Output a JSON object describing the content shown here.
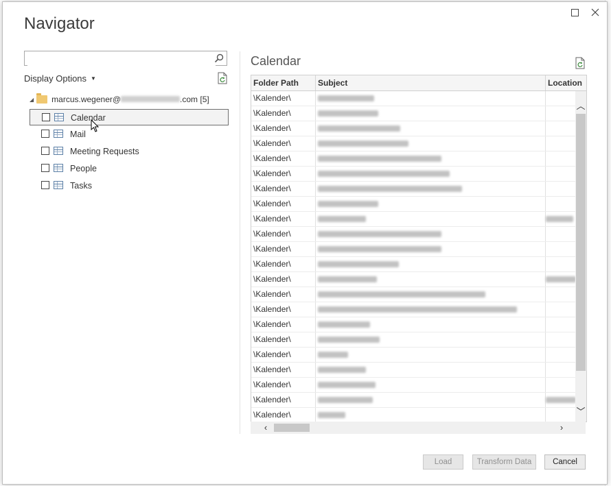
{
  "dialog": {
    "title": "Navigator",
    "window_controls": {
      "maximize_icon": "maximize-icon",
      "close_icon": "close-icon"
    }
  },
  "left_pane": {
    "search": {
      "value": "",
      "placeholder": ""
    },
    "display_options_label": "Display Options",
    "tree": {
      "root": {
        "label_prefix": "marcus.wegener@",
        "label_suffix": ".com [5]"
      },
      "items": [
        {
          "label": "Calendar",
          "selected": true,
          "checked": false
        },
        {
          "label": "Mail",
          "selected": false,
          "checked": false
        },
        {
          "label": "Meeting Requests",
          "selected": false,
          "checked": false
        },
        {
          "label": "People",
          "selected": false,
          "checked": false
        },
        {
          "label": "Tasks",
          "selected": false,
          "checked": false
        }
      ]
    }
  },
  "preview": {
    "title": "Calendar",
    "columns": [
      "Folder Path",
      "Subject",
      "Location"
    ],
    "rows": [
      "\\Kalender\\",
      "\\Kalender\\",
      "\\Kalender\\",
      "\\Kalender\\",
      "\\Kalender\\",
      "\\Kalender\\",
      "\\Kalender\\",
      "\\Kalender\\",
      "\\Kalender\\",
      "\\Kalender\\",
      "\\Kalender\\",
      "\\Kalender\\",
      "\\Kalender\\",
      "\\Kalender\\",
      "\\Kalender\\",
      "\\Kalender\\",
      "\\Kalender\\",
      "\\Kalender\\",
      "\\Kalender\\",
      "\\Kalender\\",
      "\\Kalender\\",
      "\\Kalender\\",
      "\\Kalender\\"
    ]
  },
  "buttons": {
    "load": "Load",
    "transform": "Transform Data",
    "cancel": "Cancel"
  },
  "colors": {
    "accent_border": "#6e6e6e",
    "scroll_thumb": "#c8c8c8",
    "disabled_text": "#8f8f8f"
  }
}
